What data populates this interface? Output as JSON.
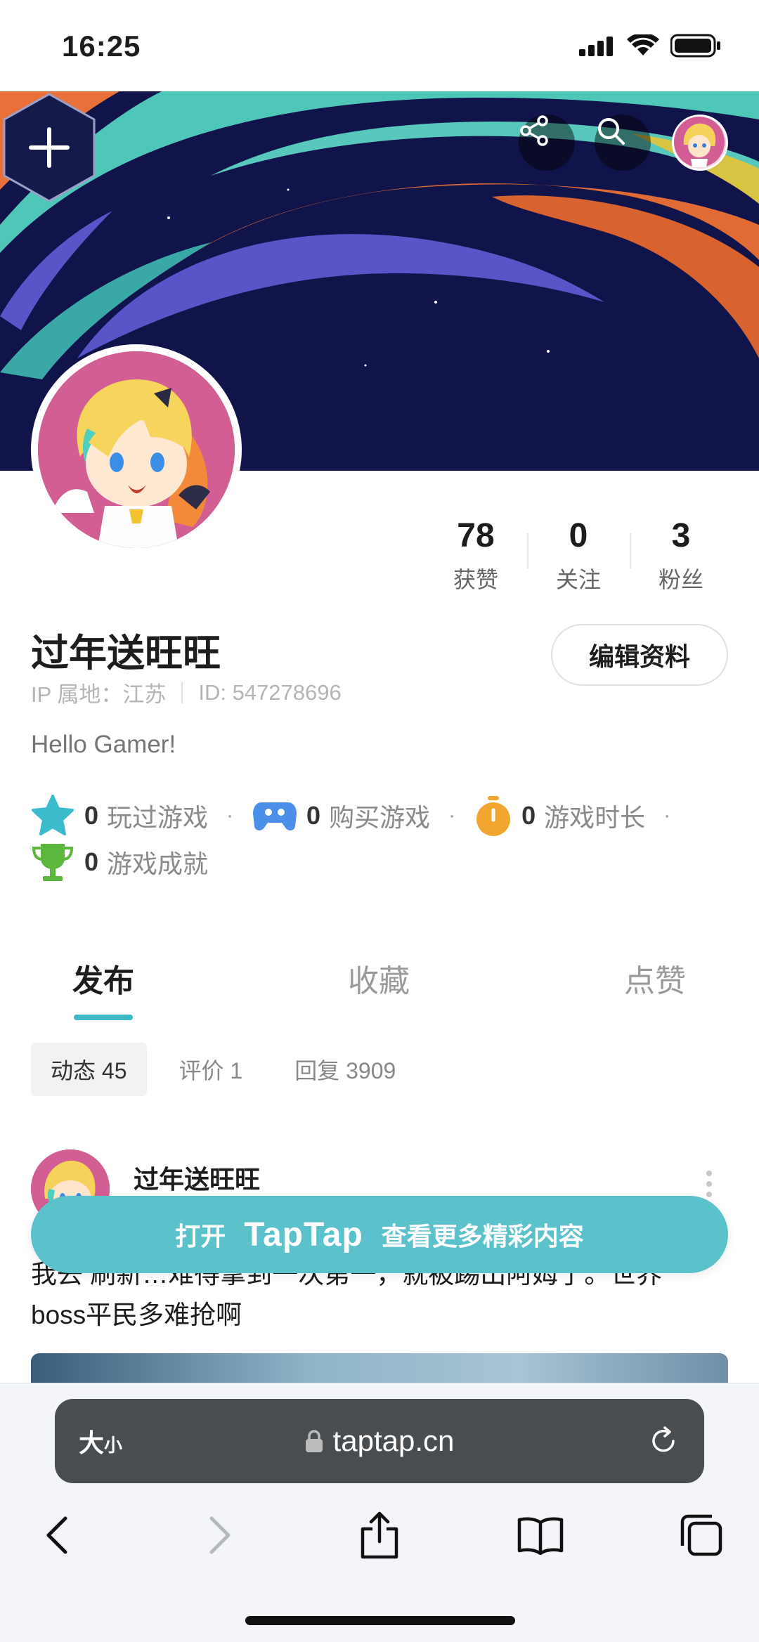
{
  "status_bar": {
    "time": "16:25"
  },
  "profile": {
    "username": "过年送旺旺",
    "ip_label": "IP 属地：江苏",
    "id_label": "ID: 547278696",
    "bio": "Hello Gamer!",
    "edit_button": "编辑资料",
    "stats": [
      {
        "value": "78",
        "label": "获赞"
      },
      {
        "value": "0",
        "label": "关注"
      },
      {
        "value": "3",
        "label": "粉丝"
      }
    ],
    "game_stats": [
      {
        "icon": "star-icon",
        "value": "0",
        "label": "玩过游戏"
      },
      {
        "icon": "gamepad-icon",
        "value": "0",
        "label": "购买游戏"
      },
      {
        "icon": "stopwatch-icon",
        "value": "0",
        "label": "游戏时长"
      },
      {
        "icon": "trophy-icon",
        "value": "0",
        "label": "游戏成就"
      }
    ]
  },
  "tabs": [
    {
      "label": "发布",
      "active": true
    },
    {
      "label": "收藏",
      "active": false
    },
    {
      "label": "点赞",
      "active": false
    }
  ],
  "subtabs": [
    {
      "label": "动态 45",
      "active": true
    },
    {
      "label": "评价 1",
      "active": false
    },
    {
      "label": "回复 3909",
      "active": false
    }
  ],
  "post": {
    "author": "过年送旺旺",
    "text_line1": "我去 刷新…难得拿到一次第一，就被踢出阿姆了。世界",
    "text_line2": "boss平民多难抢啊"
  },
  "open_app_banner": {
    "prefix": "打开",
    "brand": "TapTap",
    "suffix": "查看更多精彩内容"
  },
  "browser": {
    "size_label_big": "大",
    "size_label_small": "小",
    "url": "taptap.cn"
  },
  "colors": {
    "accent": "#3ab8c4",
    "open_app_bg": "#5bc2cc",
    "banner_dark": "#0f1246",
    "avatar_pink": "#d35e94"
  }
}
